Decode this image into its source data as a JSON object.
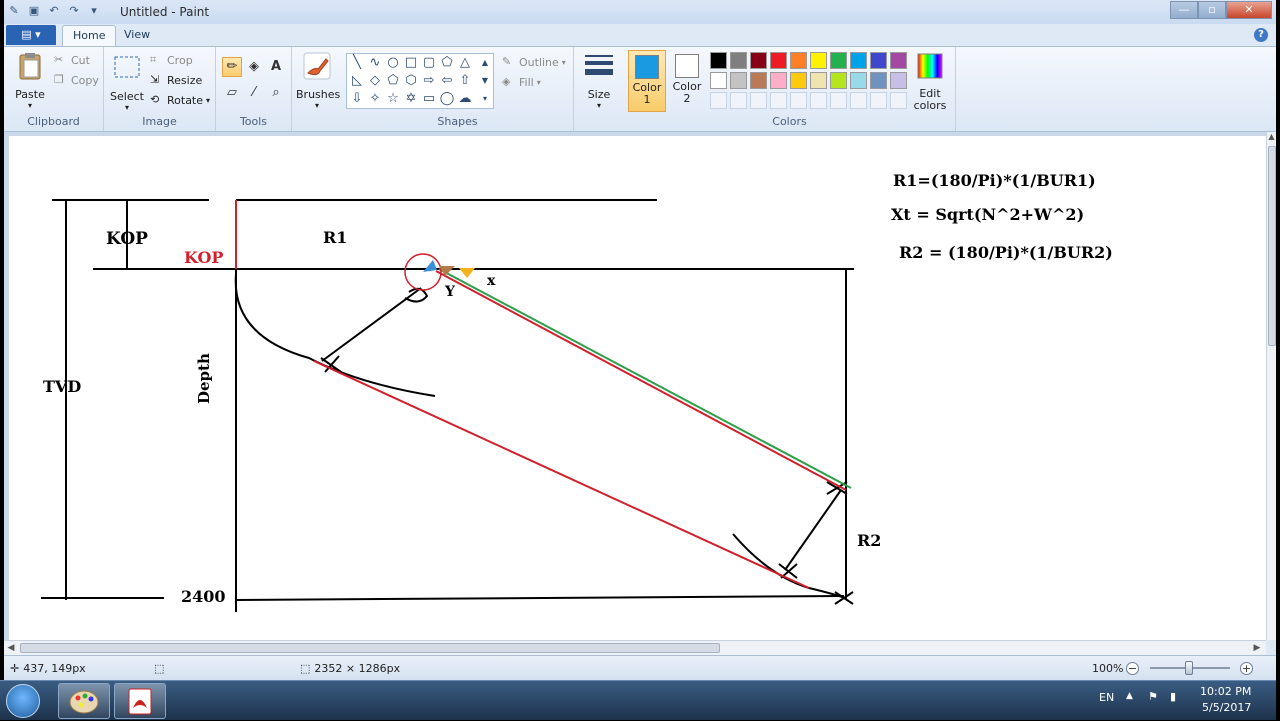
{
  "window": {
    "title": "Untitled - Paint",
    "controls": {
      "minimize": "—",
      "maximize": "▫",
      "close": "✕"
    }
  },
  "tabs": {
    "file": "▤ ▾",
    "home": "Home",
    "view": "View"
  },
  "ribbon": {
    "clipboard": {
      "label": "Clipboard",
      "paste": "Paste",
      "cut": "Cut",
      "copy": "Copy"
    },
    "image": {
      "label": "Image",
      "select": "Select",
      "crop": "Crop",
      "resize": "Resize",
      "rotate": "Rotate"
    },
    "tools": {
      "label": "Tools"
    },
    "brushes": {
      "label": "Brushes"
    },
    "shapes": {
      "label": "Shapes",
      "outline": "Outline",
      "fill": "Fill"
    },
    "size": {
      "label": "Size"
    },
    "colors": {
      "label": "Colors",
      "color1": "Color 1",
      "color2": "Color 2",
      "edit": "Edit colors",
      "color1_value": "#1a9ae0",
      "color2_value": "#ffffff",
      "palette_row1": [
        "#000000",
        "#7f7f7f",
        "#880015",
        "#ed1c24",
        "#ff7f27",
        "#fff200",
        "#22b14c",
        "#00a2e8",
        "#3f48cc",
        "#a349a4"
      ],
      "palette_row2": [
        "#ffffff",
        "#c3c3c3",
        "#b97a57",
        "#ffaec9",
        "#ffc90e",
        "#efe4b0",
        "#b5e61d",
        "#99d9ea",
        "#7092be",
        "#c8bfe7"
      ]
    }
  },
  "canvas_text": {
    "kop_left": "KOP",
    "kop_red": "KOP",
    "r1": "R1",
    "tvd": "TVD",
    "depth": "Depth",
    "y": "Y",
    "x": "x",
    "r2": "R2",
    "depth_value": "2400",
    "eq1": "R1=(180/Pi)*(1/BUR1)",
    "eq2": "Xt = Sqrt(N^2+W^2)",
    "eq3": "R2 = (180/Pi)*(1/BUR2)"
  },
  "status": {
    "cursor": "437, 149px",
    "image_size": "2352 × 1286px",
    "zoom": "100%"
  },
  "taskbar": {
    "lang": "EN",
    "time": "10:02 PM",
    "date": "5/5/2017"
  }
}
